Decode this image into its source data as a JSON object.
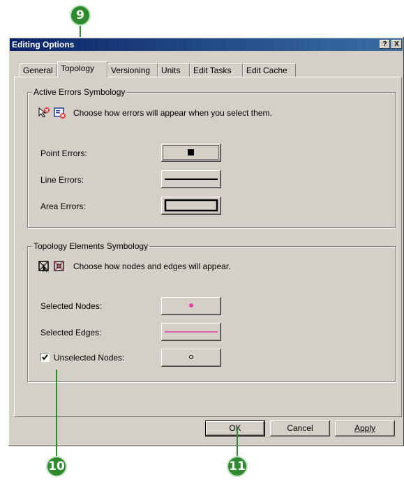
{
  "callouts": {
    "c9": "9",
    "c10": "10",
    "c11": "11"
  },
  "window": {
    "title": "Editing Options",
    "help_btn": "?",
    "close_btn": "X"
  },
  "tabs": [
    {
      "label": "General"
    },
    {
      "label": "Topology"
    },
    {
      "label": "Versioning"
    },
    {
      "label": "Units"
    },
    {
      "label": "Edit Tasks"
    },
    {
      "label": "Edit Cache"
    }
  ],
  "active_errors": {
    "title": "Active Errors Symbology",
    "description": "Choose how errors will appear when you select them.",
    "rows": [
      {
        "label": "Point Errors:"
      },
      {
        "label": "Line Errors:"
      },
      {
        "label": "Area Errors:"
      }
    ]
  },
  "topology_elements": {
    "title": "Topology Elements Symbology",
    "description": "Choose how nodes and edges will appear.",
    "rows": [
      {
        "label": "Selected Nodes:"
      },
      {
        "label": "Selected Edges:"
      },
      {
        "label": "Unselected Nodes:",
        "checked": true
      }
    ]
  },
  "buttons": {
    "ok": "OK",
    "cancel": "Cancel",
    "apply": "Apply"
  },
  "colors": {
    "selected_node": "#e040a0",
    "selected_edge": "#e060b0",
    "callout": "#2e8a2e",
    "title_bar": "#0a246a"
  }
}
